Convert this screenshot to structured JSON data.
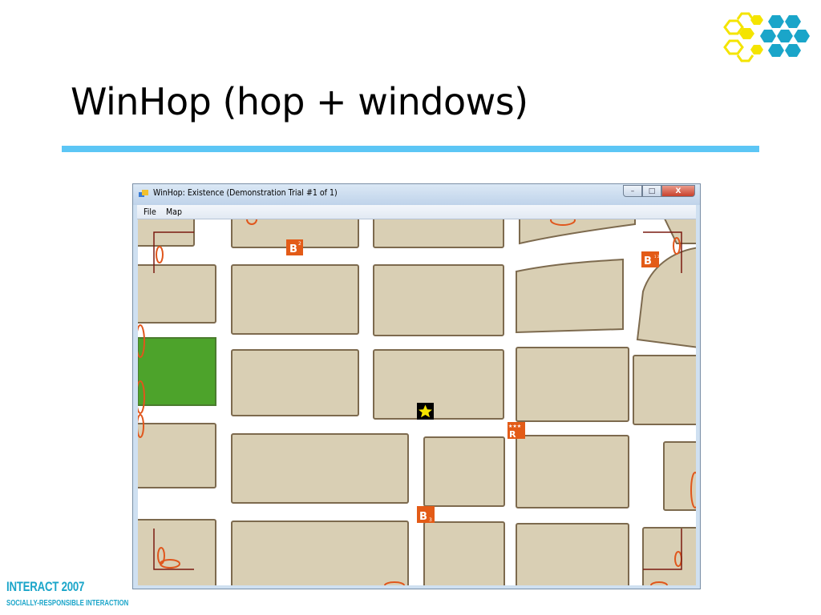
{
  "slide": {
    "title": "WinHop (hop + windows)",
    "footer_title": "INTERACT 2007",
    "footer_subtitle": "SOCIALLY-RESPONSIBLE INTERACTION"
  },
  "window": {
    "title": "WinHop: Existence (Demonstration Trial #1 of 1)",
    "menu": [
      "File",
      "Map"
    ],
    "controls": {
      "minimize": "–",
      "maximize": "□",
      "close": "X"
    }
  },
  "map": {
    "landmarks": [
      {
        "kind": "bus-stop",
        "label": "B",
        "suffix": "2"
      },
      {
        "kind": "bus-stop",
        "label": "B",
        "suffix": "1 2 3"
      },
      {
        "kind": "restaurant",
        "label": "R",
        "suffix": "★★★"
      },
      {
        "kind": "bus-stop",
        "label": "B",
        "suffix": "3"
      }
    ],
    "marker": "current-location-star",
    "colors": {
      "block": "#d9cfb4",
      "block_border": "#7d6a4e",
      "park": "#4da32b",
      "street": "#ffffff",
      "landmark": "#e35b17",
      "halo": "#e0561c",
      "corner_bracket": "#7a1a10"
    }
  },
  "colors": {
    "accent": "#5cc6f5",
    "brand": "#1aa5c9",
    "logo_yellow": "#f4e400"
  }
}
